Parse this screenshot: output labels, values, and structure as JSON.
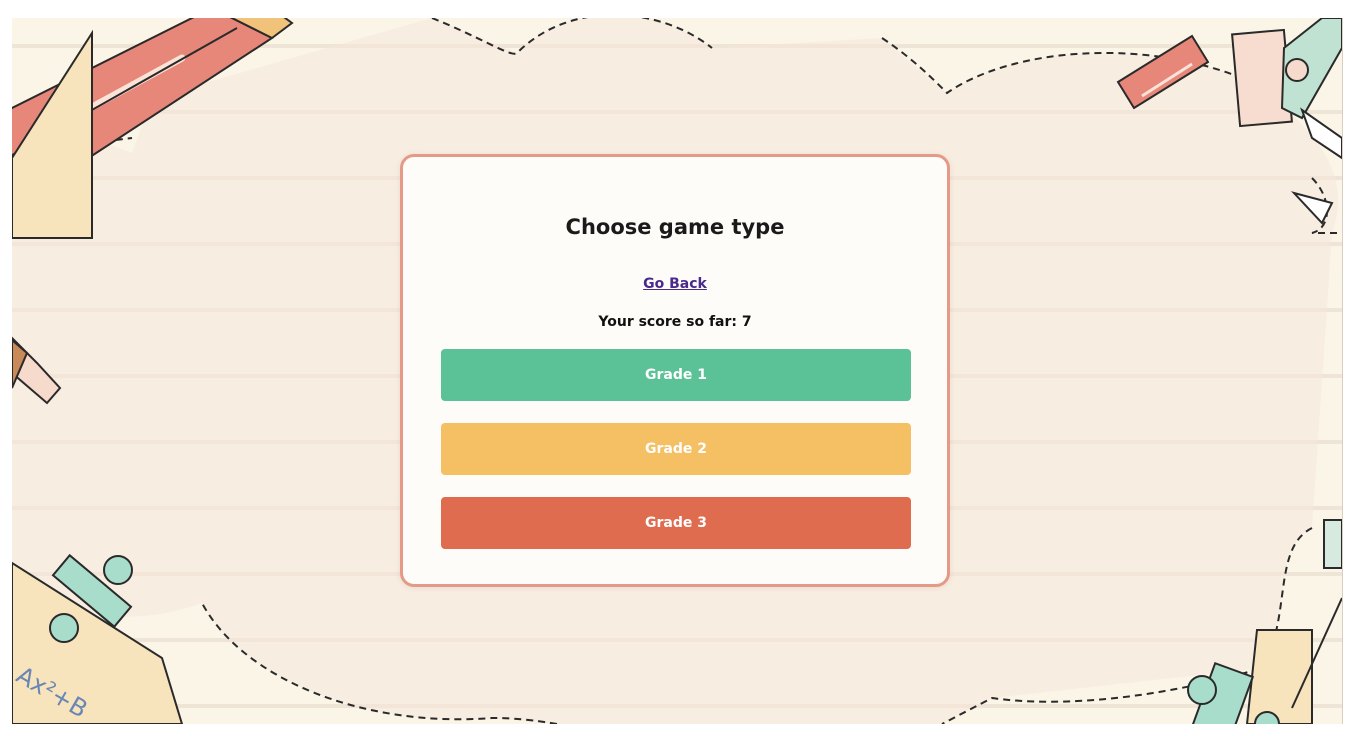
{
  "menu": {
    "title": "Choose game type",
    "back_label": "Go Back",
    "score_text": "Your score so far: 7"
  },
  "grades": [
    {
      "label": "Grade 1",
      "color": "#5bc196"
    },
    {
      "label": "Grade 2",
      "color": "#f4c063"
    },
    {
      "label": "Grade 3",
      "color": "#e06c50"
    }
  ],
  "decor": {
    "math_text": "Ax²+B"
  },
  "colors": {
    "page_bg": "#fbf5e8",
    "card_border": "#e59a88",
    "link": "#4a2a8a"
  }
}
